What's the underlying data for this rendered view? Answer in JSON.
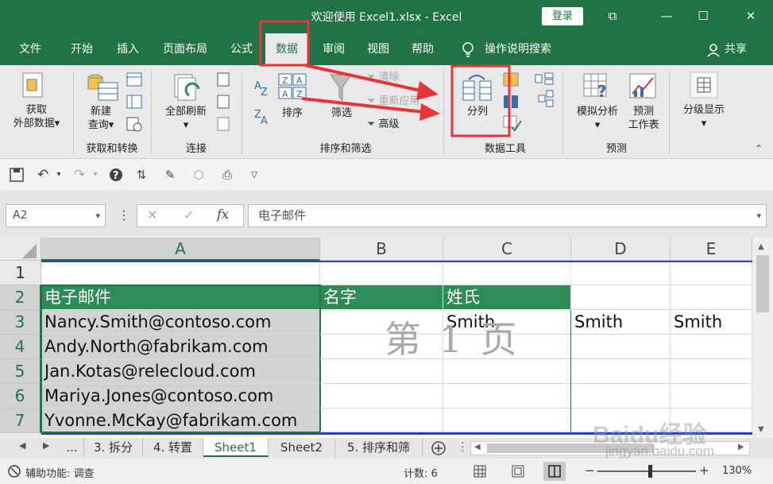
{
  "window": {
    "title": "欢迎使用 Excel1.xlsx  -  Excel",
    "login": "登录",
    "controls": [
      "⧉",
      "—",
      "☐",
      "✕"
    ]
  },
  "menu": {
    "tabs": [
      "文件",
      "开始",
      "插入",
      "页面布局",
      "公式",
      "数据",
      "审阅",
      "视图",
      "帮助"
    ],
    "tell_me": "操作说明搜索",
    "share": "共享"
  },
  "ribbon": {
    "get_data": [
      "获取",
      "外部数据"
    ],
    "new_query": [
      "新建",
      "查询"
    ],
    "group_get": "获取和转换",
    "refresh_all": "全部刷新",
    "group_connect": "连接",
    "sort_az": "A↓Z",
    "sort_label": "排序",
    "filter_label": "筛选",
    "clear": "清除",
    "reapply": "重新应用",
    "advanced": "高级",
    "group_sort": "排序和筛选",
    "text_to_columns": "分列",
    "group_tools": "数据工具",
    "whatif": "模拟分析",
    "forecast": [
      "预测",
      "工作表"
    ],
    "group_forecast": "预测",
    "outline": "分级显示"
  },
  "formula_bar": {
    "name_box": "A2",
    "formula": "电子邮件"
  },
  "grid": {
    "columns": [
      "A",
      "B",
      "C",
      "D",
      "E"
    ],
    "rows": [
      "1",
      "2",
      "3",
      "4",
      "5",
      "6",
      "7"
    ],
    "header_row": [
      "电子邮件",
      "名字",
      "姓氏"
    ],
    "emails": [
      "Nancy.Smith@contoso.com",
      "Andy.North@fabrikam.com",
      "Jan.Kotas@relecloud.com",
      "Mariya.Jones@contoso.com",
      "Yvonne.McKay@fabrikam.com"
    ],
    "row3_c": "Smith",
    "row3_d": "Smith",
    "row3_e": "Smith",
    "page_watermark": "第 1 页"
  },
  "sheet_tabs": [
    "...",
    "3. 拆分",
    "4. 转置",
    "Sheet1",
    "Sheet2",
    "5. 排序和筛"
  ],
  "status": {
    "accessibility": "辅助功能: 调查",
    "count": "计数: 6",
    "zoom": "130%"
  },
  "watermark": {
    "brand": "Baidu经验",
    "url": "jingyan.baidu.com"
  },
  "colors": {
    "excel_green": "#217346",
    "header_fill": "#2e8b57",
    "annotation_red": "#e8333a"
  }
}
